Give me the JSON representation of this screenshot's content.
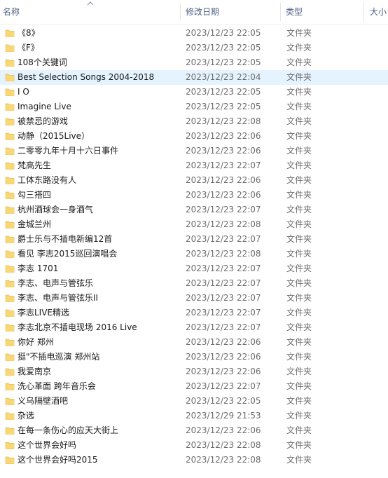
{
  "columns": {
    "name": "名称",
    "date": "修改日期",
    "type": "类型",
    "size": "大小"
  },
  "colors": {
    "folder": "#f8d775",
    "folder_dark": "#e8b84a",
    "hover": "#e5f3ff"
  },
  "files": [
    {
      "name": "《8》",
      "date": "2023/12/23 22:05",
      "type": "文件夹"
    },
    {
      "name": "《F》",
      "date": "2023/12/23 22:05",
      "type": "文件夹"
    },
    {
      "name": "108个关键词",
      "date": "2023/12/23 22:05",
      "type": "文件夹"
    },
    {
      "name": "Best Selection Songs 2004-2018",
      "date": "2023/12/23 22:04",
      "type": "文件夹",
      "hover": true
    },
    {
      "name": "I O",
      "date": "2023/12/23 22:05",
      "type": "文件夹"
    },
    {
      "name": "Imagine Live",
      "date": "2023/12/23 22:05",
      "type": "文件夹"
    },
    {
      "name": "被禁忌的游戏",
      "date": "2023/12/23 22:08",
      "type": "文件夹"
    },
    {
      "name": "动静（2015Live）",
      "date": "2023/12/23 22:06",
      "type": "文件夹"
    },
    {
      "name": "二零零九年十月十六日事件",
      "date": "2023/12/23 22:06",
      "type": "文件夹"
    },
    {
      "name": "梵高先生",
      "date": "2023/12/23 22:07",
      "type": "文件夹"
    },
    {
      "name": "工体东路没有人",
      "date": "2023/12/23 22:06",
      "type": "文件夹"
    },
    {
      "name": "勾三搭四",
      "date": "2023/12/23 22:06",
      "type": "文件夹"
    },
    {
      "name": "杭州酒球会一身酒气",
      "date": "2023/12/23 22:07",
      "type": "文件夹"
    },
    {
      "name": "金城兰州",
      "date": "2023/12/23 22:08",
      "type": "文件夹"
    },
    {
      "name": "爵士乐与不插电新编12首",
      "date": "2023/12/23 22:07",
      "type": "文件夹"
    },
    {
      "name": "看见  李志2015巡回演唱会",
      "date": "2023/12/23 22:08",
      "type": "文件夹"
    },
    {
      "name": "李志 1701",
      "date": "2023/12/23 22:07",
      "type": "文件夹"
    },
    {
      "name": "李志、电声与管弦乐",
      "date": "2023/12/23 22:07",
      "type": "文件夹"
    },
    {
      "name": "李志、电声与管弦乐II",
      "date": "2023/12/23 22:07",
      "type": "文件夹"
    },
    {
      "name": "李志LIVE精选",
      "date": "2023/12/23 22:07",
      "type": "文件夹"
    },
    {
      "name": "李志北京不插电现场 2016 Live",
      "date": "2023/12/23 22:07",
      "type": "文件夹"
    },
    {
      "name": "你好 郑州",
      "date": "2023/12/23 22:06",
      "type": "文件夹"
    },
    {
      "name": "挺\"不插电巡演 郑州站",
      "date": "2023/12/23 22:06",
      "type": "文件夹"
    },
    {
      "name": "我爱南京",
      "date": "2023/12/23 22:06",
      "type": "文件夹"
    },
    {
      "name": "洗心革面 跨年音乐会",
      "date": "2023/12/23 22:07",
      "type": "文件夹"
    },
    {
      "name": "义乌隔壁酒吧",
      "date": "2023/12/23 22:05",
      "type": "文件夹"
    },
    {
      "name": "杂选",
      "date": "2023/12/29 21:53",
      "type": "文件夹"
    },
    {
      "name": "在每一条伤心的应天大街上",
      "date": "2023/12/23 22:06",
      "type": "文件夹"
    },
    {
      "name": "这个世界会好吗",
      "date": "2023/12/23 22:08",
      "type": "文件夹"
    },
    {
      "name": "这个世界会好吗2015",
      "date": "2023/12/23 22:08",
      "type": "文件夹"
    }
  ]
}
